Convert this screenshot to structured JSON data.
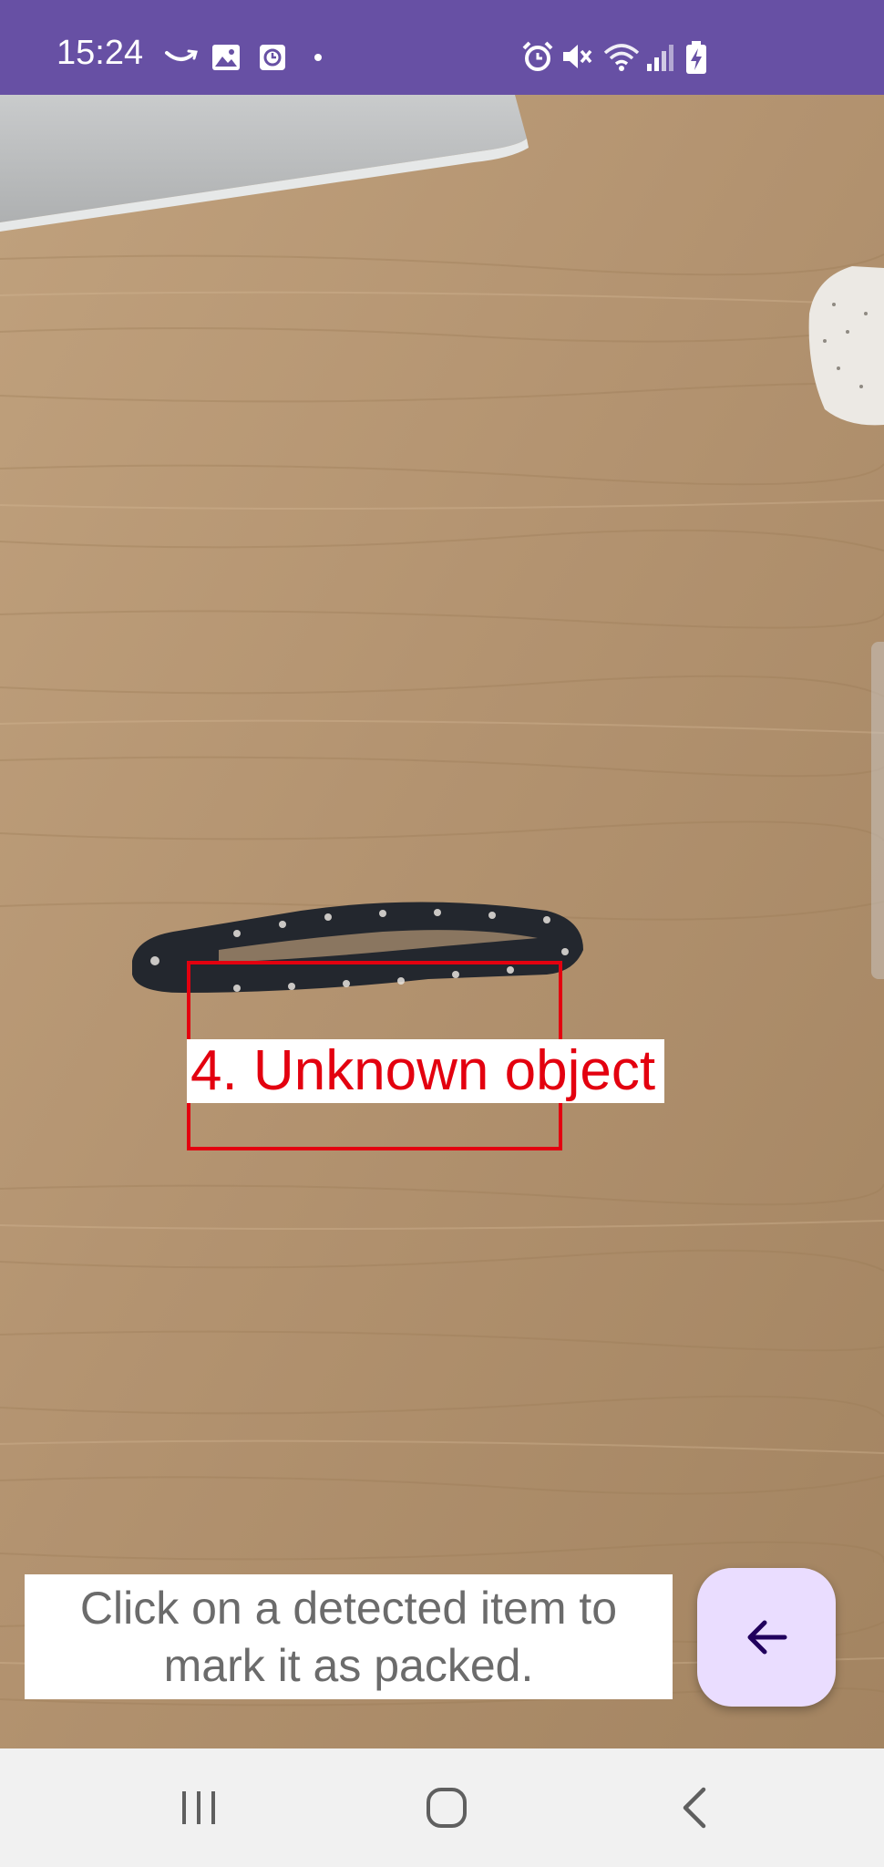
{
  "status_bar": {
    "time": "15:24",
    "background": "#6750a4",
    "left_icons": [
      "amazon-smile-icon",
      "image-icon",
      "clock-app-icon",
      "dot-icon"
    ],
    "right_icons": [
      "alarm-icon",
      "mute-icon",
      "wifi-icon",
      "signal-icon",
      "battery-charging-icon"
    ]
  },
  "detection": {
    "label": "4. Unknown object",
    "color": "#e3000f"
  },
  "hint": {
    "text": "Click on a detected item to mark it as packed."
  },
  "fab": {
    "icon": "arrow-back-icon",
    "background": "#eaddff"
  },
  "nav_bar": {
    "buttons": [
      "recent-apps-icon",
      "home-icon",
      "back-icon"
    ]
  }
}
